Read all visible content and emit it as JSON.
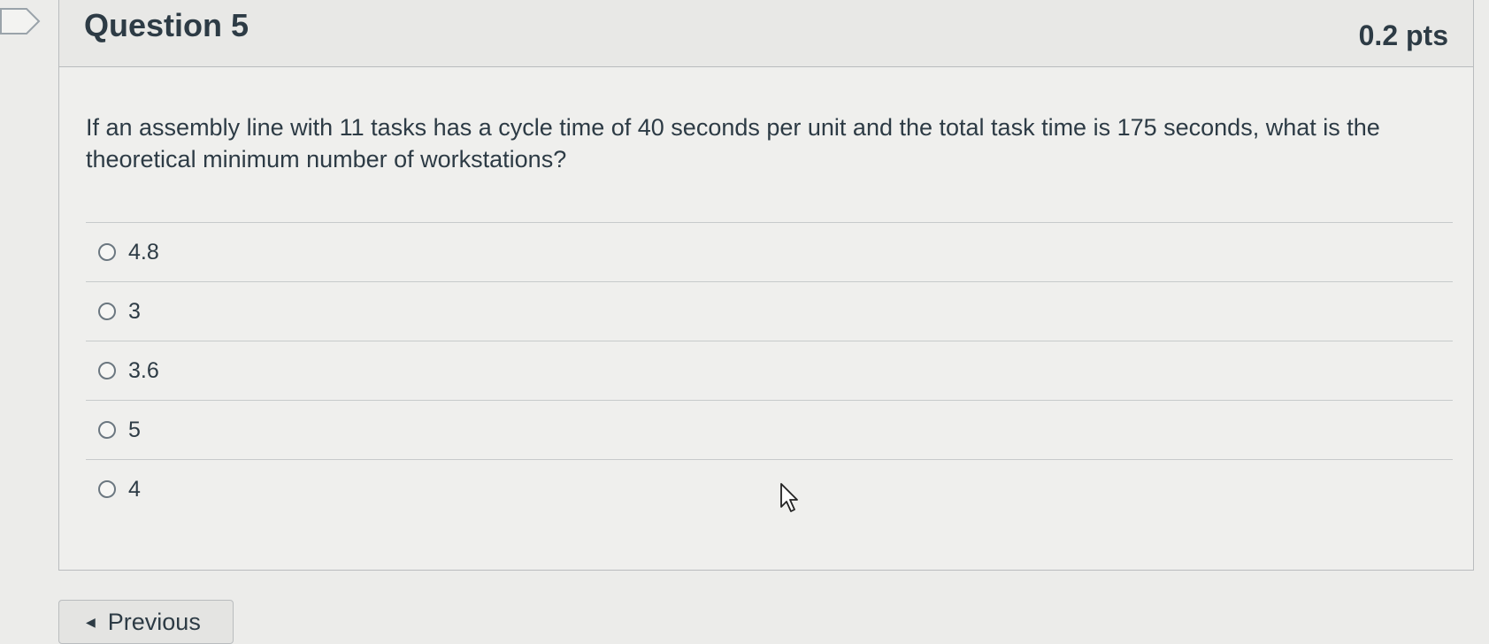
{
  "question": {
    "title": "Question 5",
    "points": "0.2 pts",
    "text": "If an assembly line with 11 tasks has a cycle time of 40 seconds per unit and the total task time is 175 seconds, what is the theoretical minimum number of workstations?"
  },
  "answers": [
    {
      "label": "4.8",
      "selected": false
    },
    {
      "label": "3",
      "selected": false
    },
    {
      "label": "3.6",
      "selected": false
    },
    {
      "label": "5",
      "selected": false
    },
    {
      "label": "4",
      "selected": false
    }
  ],
  "navigation": {
    "previous_label": "Previous"
  },
  "icons": {
    "bookmark": "bookmark-flag-icon",
    "previous": "triangle-left-icon",
    "cursor": "mouse-pointer-icon"
  }
}
